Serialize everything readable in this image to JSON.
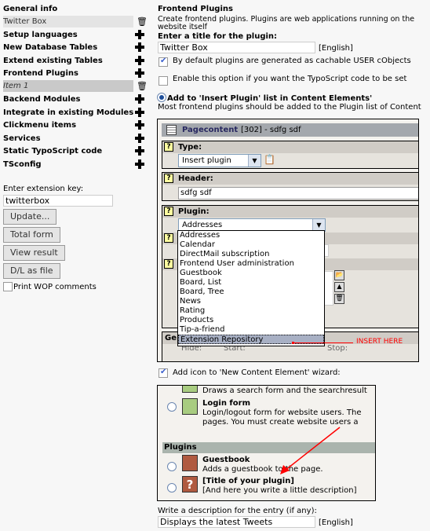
{
  "sidebar": {
    "items": [
      {
        "label": "General info",
        "action": "none"
      },
      {
        "label": "Twitter Box",
        "action": "trash-icon",
        "selected": true
      },
      {
        "label": "Setup languages",
        "action": "plus-icon"
      },
      {
        "label": "New Database Tables",
        "action": "plus-icon"
      },
      {
        "label": "Extend existing Tables",
        "action": "plus-icon"
      },
      {
        "label": "Frontend Plugins",
        "action": "plus-icon"
      },
      {
        "label": "Item 1",
        "action": "trash-icon",
        "selected": true
      },
      {
        "label": "Backend Modules",
        "action": "plus-icon"
      },
      {
        "label": "Integrate in existing Modules",
        "action": "plus-icon"
      },
      {
        "label": "Clickmenu items",
        "action": "plus-icon"
      },
      {
        "label": "Services",
        "action": "plus-icon"
      },
      {
        "label": "Static TypoScript code",
        "action": "plus-icon"
      },
      {
        "label": "TSconfig",
        "action": "plus-icon"
      }
    ],
    "ext_key_label": "Enter extension key:",
    "ext_key_value": "twitterbox",
    "buttons": [
      "Update...",
      "Total form",
      "View result",
      "D/L as file"
    ],
    "print_wop": "Print WOP comments"
  },
  "main": {
    "title": "Frontend Plugins",
    "description": "Create frontend plugins. Plugins are web applications running on the website itself",
    "title_label": "Enter a title for the plugin:",
    "title_value": "Twitter Box",
    "lang": "[English]",
    "opt_cached": "By default plugins are generated as cachable USER cObjects",
    "opt_cached_checked": true,
    "opt_typoscript": "Enable this option if you want the TypoScript code to be set",
    "opt_typoscript_checked": false,
    "radio_insert": "Add to 'Insert Plugin' list in Content Elements'",
    "radio_insert_desc": "Most frontend plugins should be added to the Plugin list of Content",
    "wizard_label": "Add icon to 'New Content Element' wizard:",
    "wizard_checked": true,
    "entry_desc_label": "Write a description for the entry (if any):",
    "entry_desc_value": "Displays the latest Tweets"
  },
  "preview1": {
    "table": "Pagecontent",
    "record": "[302] - sdfg sdf",
    "type_label": "Type:",
    "type_value": "Insert plugin",
    "header_label": "Header:",
    "header_value": "sdfg sdf",
    "plugin_label": "Plugin:",
    "plugin_value": "Addresses",
    "plugin_options": [
      "Addresses",
      "Calendar",
      "DirectMail subscription",
      "Frontend User administration",
      "Guestbook",
      "Board, List",
      "Board, Tree",
      "News",
      "Rating",
      "Products",
      "Tip-a-friend",
      "Extension Repository"
    ],
    "highlighted_option": "Extension Repository",
    "gen_label": "Ge",
    "hide": "Hide:",
    "start": "Start:",
    "stop": "Stop:",
    "annotation": "INSERT HERE",
    "annotation_color": "#ff0000"
  },
  "preview2": {
    "search_desc": "Draws a search form and the searchresult",
    "login_title": "Login form",
    "login_desc1": "Login/logout form for website users. The",
    "login_desc2": "pages. You must create website users a",
    "section": "Plugins",
    "guestbook_title": "Guestbook",
    "guestbook_desc": "Adds a guestbook to the page.",
    "custom_title": "[Title of your plugin]",
    "custom_desc": "[And here you write a little description]"
  }
}
